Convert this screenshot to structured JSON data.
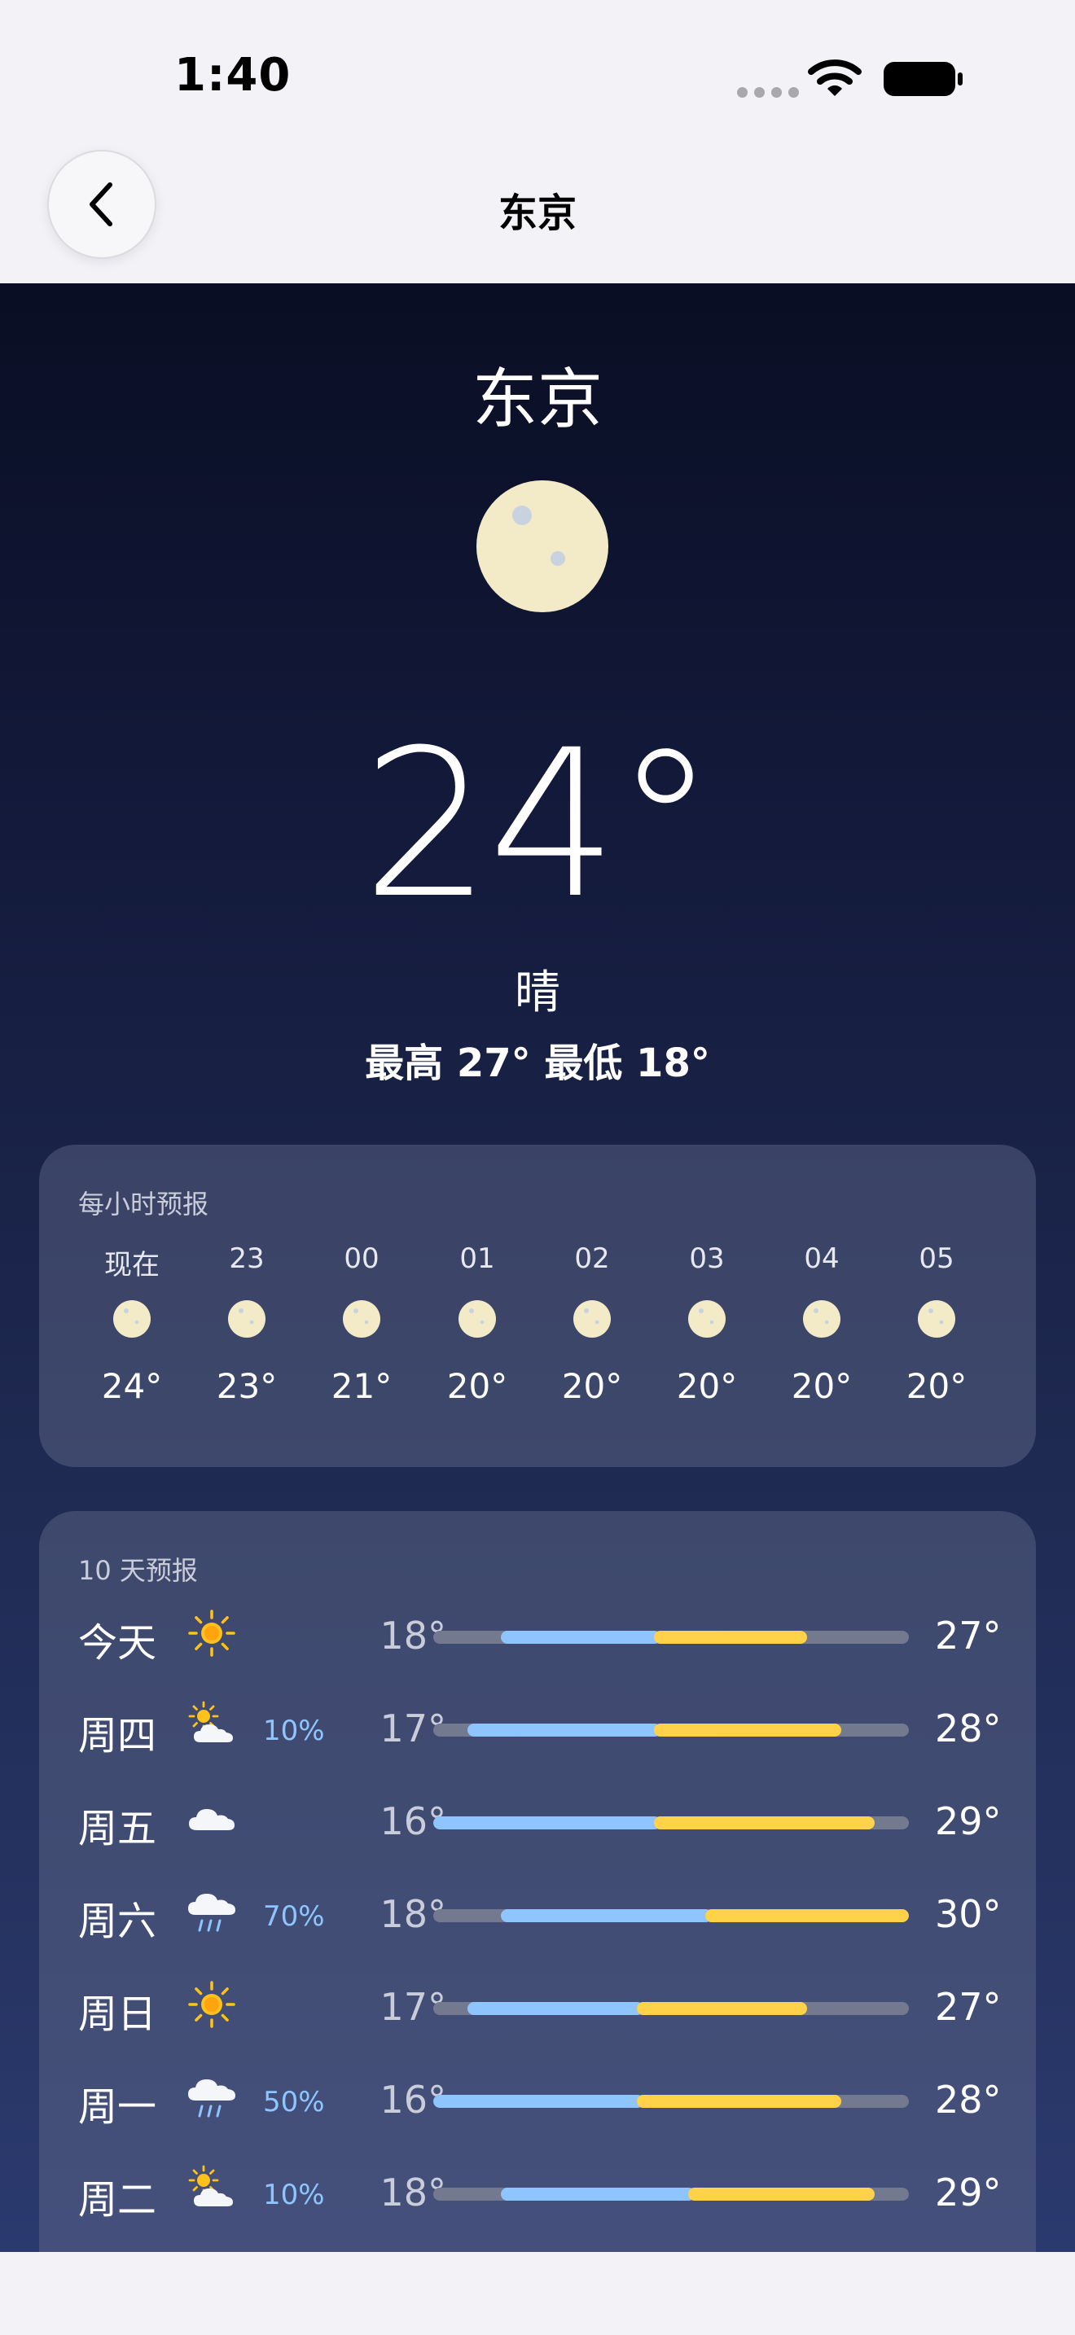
{
  "status_bar": {
    "time": "1:40"
  },
  "nav": {
    "title": "东京"
  },
  "current": {
    "city": "东京",
    "temp": "24°",
    "condition": "晴",
    "hilo": "最高 27° 最低 18°"
  },
  "hourly": {
    "title": "每小时预报",
    "items": [
      {
        "label": "现在",
        "icon": "moon-icon",
        "temp": "24°"
      },
      {
        "label": "23",
        "icon": "moon-icon",
        "temp": "23°"
      },
      {
        "label": "00",
        "icon": "moon-icon",
        "temp": "21°"
      },
      {
        "label": "01",
        "icon": "moon-icon",
        "temp": "20°"
      },
      {
        "label": "02",
        "icon": "moon-icon",
        "temp": "20°"
      },
      {
        "label": "03",
        "icon": "moon-icon",
        "temp": "20°"
      },
      {
        "label": "04",
        "icon": "moon-icon",
        "temp": "20°"
      },
      {
        "label": "05",
        "icon": "moon-icon",
        "temp": "20°"
      }
    ]
  },
  "daily": {
    "title": "10 天预报",
    "range_min": 16,
    "range_max": 30,
    "items": [
      {
        "day": "今天",
        "icon": "sun-icon",
        "precip": "",
        "low": "18°",
        "high": "27°",
        "low_v": 18,
        "high_v": 27,
        "split_v": 22.5
      },
      {
        "day": "周四",
        "icon": "partly-cloudy-icon",
        "precip": "10%",
        "low": "17°",
        "high": "28°",
        "low_v": 17,
        "high_v": 28,
        "split_v": 22.5
      },
      {
        "day": "周五",
        "icon": "cloud-icon",
        "precip": "",
        "low": "16°",
        "high": "29°",
        "low_v": 16,
        "high_v": 29,
        "split_v": 22.5
      },
      {
        "day": "周六",
        "icon": "rain-icon",
        "precip": "70%",
        "low": "18°",
        "high": "30°",
        "low_v": 18,
        "high_v": 30,
        "split_v": 24
      },
      {
        "day": "周日",
        "icon": "sun-icon",
        "precip": "",
        "low": "17°",
        "high": "27°",
        "low_v": 17,
        "high_v": 27,
        "split_v": 22
      },
      {
        "day": "周一",
        "icon": "rain-icon",
        "precip": "50%",
        "low": "16°",
        "high": "28°",
        "low_v": 16,
        "high_v": 28,
        "split_v": 22
      },
      {
        "day": "周二",
        "icon": "partly-cloudy-icon",
        "precip": "10%",
        "low": "18°",
        "high": "29°",
        "low_v": 18,
        "high_v": 29,
        "split_v": 23.5
      }
    ]
  },
  "colors": {
    "cool": "#8ec5ff",
    "warm": "#ffd24a",
    "moon": "#f3ebc7",
    "sun": "#ffc21a"
  }
}
